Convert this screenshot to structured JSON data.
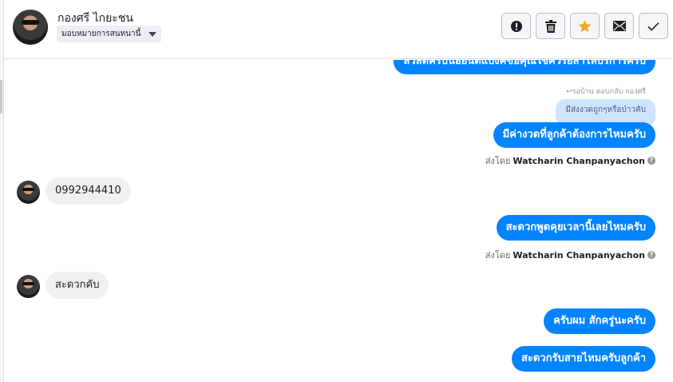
{
  "header": {
    "contact_name": "กองศรี ไกยะชน",
    "assign_label": "มอบหมายการสนทนานี้",
    "actions": [
      {
        "name": "alert-icon",
        "title": ""
      },
      {
        "name": "trash-icon",
        "title": ""
      },
      {
        "name": "star-icon",
        "title": ""
      },
      {
        "name": "envelope-icon",
        "title": ""
      },
      {
        "name": "check-icon",
        "title": ""
      }
    ],
    "accent_color": "#f5a623"
  },
  "messages": {
    "top_partial": "สวัสดีครับน้อยินดีแบงค์ขอคุณใช้คิวรียสาให้บริการครับ",
    "reply_meta": "รอบ้าน ตอบกลับ กองศรี",
    "reply_quote": "มีส่งงวดถูกๆหรือป่าวคับ",
    "out1": "มีค่างวดที่ลูกค้าต้องการไหมครับ",
    "sent_by_prefix": "ส่งโดย",
    "sent_by_name": "Watcharin Chanpanyachon",
    "in1": "0992944410",
    "out2": "สะดวกพูดคุยเวลานี้เลยไหมครับ",
    "sent_by_prefix2": "ส่งโดย",
    "sent_by_name2": "Watcharin Chanpanyachon",
    "in2": "สะดวกคับ",
    "out3": "ครับผม สักครู่นะครับ",
    "out4": "สะดวกรับสายไหมครับลูกค้า"
  },
  "colors": {
    "outgoing_bubble": "#0084ff",
    "incoming_bubble": "#f1f0f0",
    "reply_quote_bg": "#cce4ff"
  }
}
